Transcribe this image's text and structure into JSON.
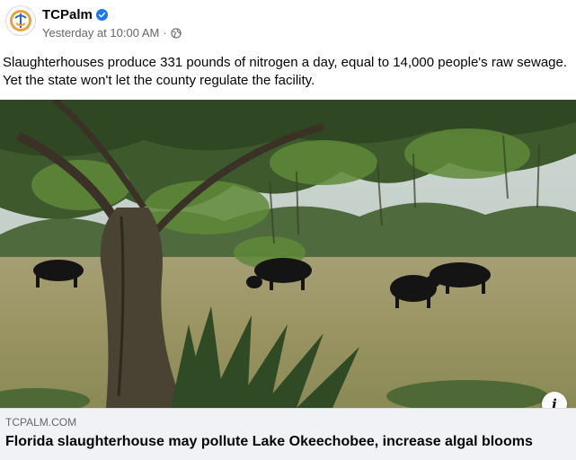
{
  "post": {
    "author": "TCPalm",
    "timestamp": "Yesterday at 10:00 AM",
    "separator": "·",
    "privacy_icon": "globe-icon",
    "verified_icon": "verified-badge-icon",
    "text": "Slaughterhouses produce 331 pounds of nitrogen a day, equal to 14,000 people's raw sewage. Yet the state won't let the county regulate the facility."
  },
  "photo": {
    "subject": "cattle-grazing-under-oak-tree"
  },
  "link_preview": {
    "domain": "TCPALM.COM",
    "title": "Florida slaughterhouse may pollute Lake Okeechobee, increase algal blooms",
    "info_label": "i"
  },
  "colors": {
    "brand_blue": "#1877f2",
    "secondary_text": "#65676b",
    "card_bg": "#f0f2f5"
  }
}
